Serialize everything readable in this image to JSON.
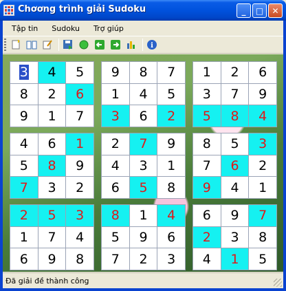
{
  "window": {
    "title": "Chơơng trình giải Sudoku"
  },
  "menu": [
    "Tập tin",
    "Sudoku",
    "Trợ giúp"
  ],
  "toolbar": [
    "new-icon",
    "open-book-icon",
    "edit-icon",
    "save-icon",
    "solve-icon",
    "back-icon",
    "forward-icon",
    "chart-icon",
    "info-icon"
  ],
  "status": {
    "text": "Đã giải đề thành công"
  },
  "colors": {
    "highlight": "#15f1f1",
    "given": "#e01818",
    "selection": "#2a4fc8"
  },
  "blocks": [
    [
      [
        "3",
        0,
        0,
        1
      ],
      [
        "4",
        1,
        0,
        0
      ],
      [
        "5",
        0,
        0,
        0
      ],
      [
        "8",
        0,
        0,
        0
      ],
      [
        "2",
        0,
        0,
        0
      ],
      [
        "6",
        1,
        1,
        0
      ],
      [
        "9",
        0,
        0,
        0
      ],
      [
        "1",
        0,
        0,
        0
      ],
      [
        "7",
        0,
        0,
        0
      ]
    ],
    [
      [
        "9",
        0,
        0,
        0
      ],
      [
        "8",
        0,
        0,
        0
      ],
      [
        "7",
        0,
        0,
        0
      ],
      [
        "1",
        0,
        0,
        0
      ],
      [
        "4",
        0,
        0,
        0
      ],
      [
        "5",
        0,
        0,
        0
      ],
      [
        "3",
        1,
        1,
        0
      ],
      [
        "6",
        0,
        0,
        0
      ],
      [
        "2",
        1,
        1,
        0
      ]
    ],
    [
      [
        "1",
        0,
        0,
        0
      ],
      [
        "2",
        0,
        0,
        0
      ],
      [
        "6",
        0,
        0,
        0
      ],
      [
        "3",
        0,
        0,
        0
      ],
      [
        "7",
        0,
        0,
        0
      ],
      [
        "9",
        0,
        0,
        0
      ],
      [
        "5",
        1,
        1,
        0
      ],
      [
        "8",
        1,
        1,
        0
      ],
      [
        "4",
        1,
        1,
        0
      ]
    ],
    [
      [
        "4",
        0,
        0,
        0
      ],
      [
        "6",
        0,
        0,
        0
      ],
      [
        "1",
        1,
        1,
        0
      ],
      [
        "5",
        0,
        0,
        0
      ],
      [
        "8",
        1,
        1,
        0
      ],
      [
        "9",
        0,
        0,
        0
      ],
      [
        "7",
        1,
        1,
        0
      ],
      [
        "3",
        0,
        0,
        0
      ],
      [
        "2",
        0,
        0,
        0
      ]
    ],
    [
      [
        "2",
        0,
        0,
        0
      ],
      [
        "7",
        1,
        1,
        0
      ],
      [
        "9",
        0,
        0,
        0
      ],
      [
        "4",
        0,
        0,
        0
      ],
      [
        "3",
        0,
        0,
        0
      ],
      [
        "1",
        0,
        0,
        0
      ],
      [
        "6",
        0,
        0,
        0
      ],
      [
        "5",
        1,
        1,
        0
      ],
      [
        "8",
        0,
        0,
        0
      ]
    ],
    [
      [
        "8",
        0,
        0,
        0
      ],
      [
        "5",
        0,
        0,
        0
      ],
      [
        "3",
        1,
        1,
        0
      ],
      [
        "7",
        0,
        0,
        0
      ],
      [
        "6",
        1,
        1,
        0
      ],
      [
        "2",
        0,
        0,
        0
      ],
      [
        "9",
        1,
        1,
        0
      ],
      [
        "4",
        0,
        0,
        0
      ],
      [
        "1",
        0,
        0,
        0
      ]
    ],
    [
      [
        "2",
        1,
        1,
        0
      ],
      [
        "5",
        1,
        1,
        0
      ],
      [
        "3",
        1,
        1,
        0
      ],
      [
        "1",
        0,
        0,
        0
      ],
      [
        "7",
        0,
        0,
        0
      ],
      [
        "4",
        0,
        0,
        0
      ],
      [
        "6",
        0,
        0,
        0
      ],
      [
        "9",
        0,
        0,
        0
      ],
      [
        "8",
        0,
        0,
        0
      ]
    ],
    [
      [
        "8",
        1,
        1,
        0
      ],
      [
        "1",
        0,
        0,
        0
      ],
      [
        "4",
        1,
        1,
        0
      ],
      [
        "5",
        0,
        0,
        0
      ],
      [
        "9",
        0,
        0,
        0
      ],
      [
        "6",
        0,
        0,
        0
      ],
      [
        "7",
        0,
        0,
        0
      ],
      [
        "2",
        0,
        0,
        0
      ],
      [
        "3",
        0,
        0,
        0
      ]
    ],
    [
      [
        "6",
        0,
        0,
        0
      ],
      [
        "9",
        0,
        0,
        0
      ],
      [
        "7",
        1,
        1,
        0
      ],
      [
        "2",
        1,
        1,
        0
      ],
      [
        "3",
        0,
        0,
        0
      ],
      [
        "8",
        0,
        0,
        0
      ],
      [
        "4",
        0,
        0,
        0
      ],
      [
        "1",
        1,
        1,
        0
      ],
      [
        "5",
        0,
        0,
        0
      ]
    ]
  ]
}
